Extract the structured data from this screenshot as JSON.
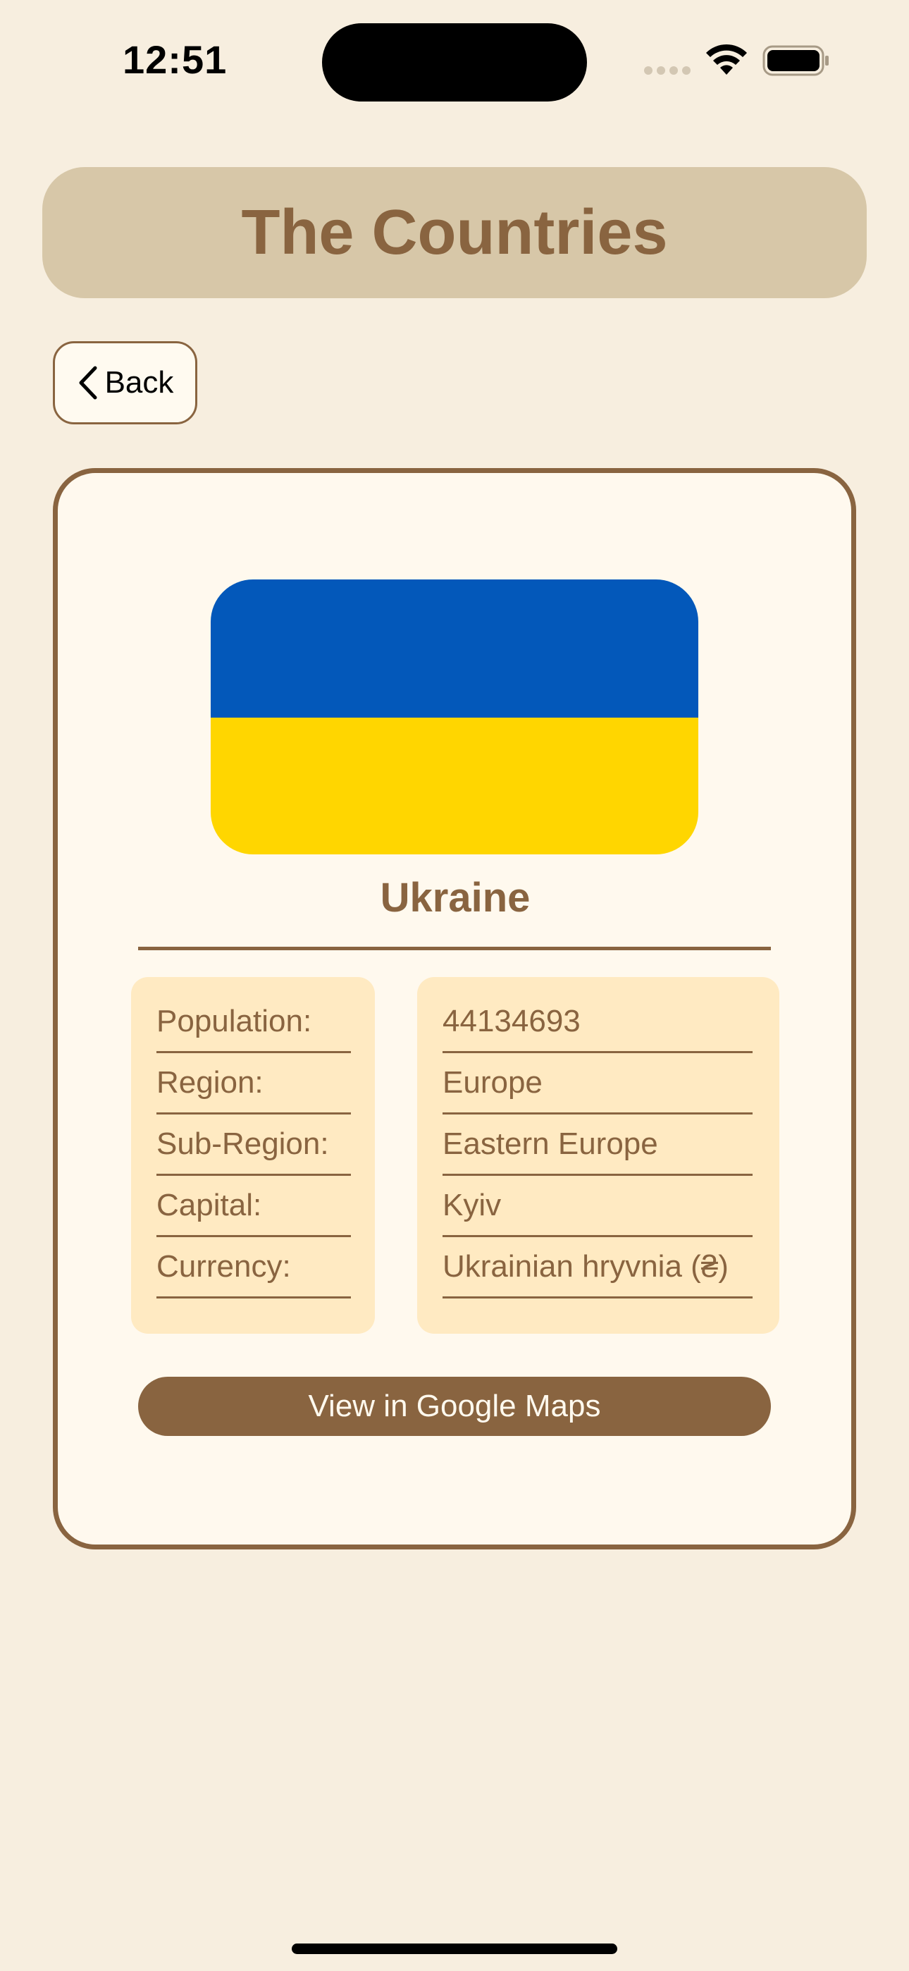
{
  "status_bar": {
    "time": "12:51"
  },
  "header": {
    "title": "The Countries"
  },
  "navigation": {
    "back_label": "Back"
  },
  "country": {
    "name": "Ukraine",
    "flag_colors": [
      "#0358BA",
      "#FFD600"
    ],
    "details": [
      {
        "label": "Population:",
        "value": "44134693"
      },
      {
        "label": "Region:",
        "value": "Europe"
      },
      {
        "label": "Sub-Region:",
        "value": "Eastern Europe"
      },
      {
        "label": "Capital:",
        "value": "Kyiv"
      },
      {
        "label": "Currency:",
        "value": "Ukrainian hryvnia (₴)"
      }
    ]
  },
  "actions": {
    "maps_label": "View in Google Maps"
  },
  "theme": {
    "background": "#F7EEDF",
    "accent": "#896440",
    "header_bg": "#D7C7A8",
    "card_bg": "#FFF9EE",
    "info_bg": "#FFEAC2"
  },
  "icons": [
    "cellular-signal-icon",
    "wifi-icon",
    "battery-icon",
    "chevron-left-icon"
  ]
}
